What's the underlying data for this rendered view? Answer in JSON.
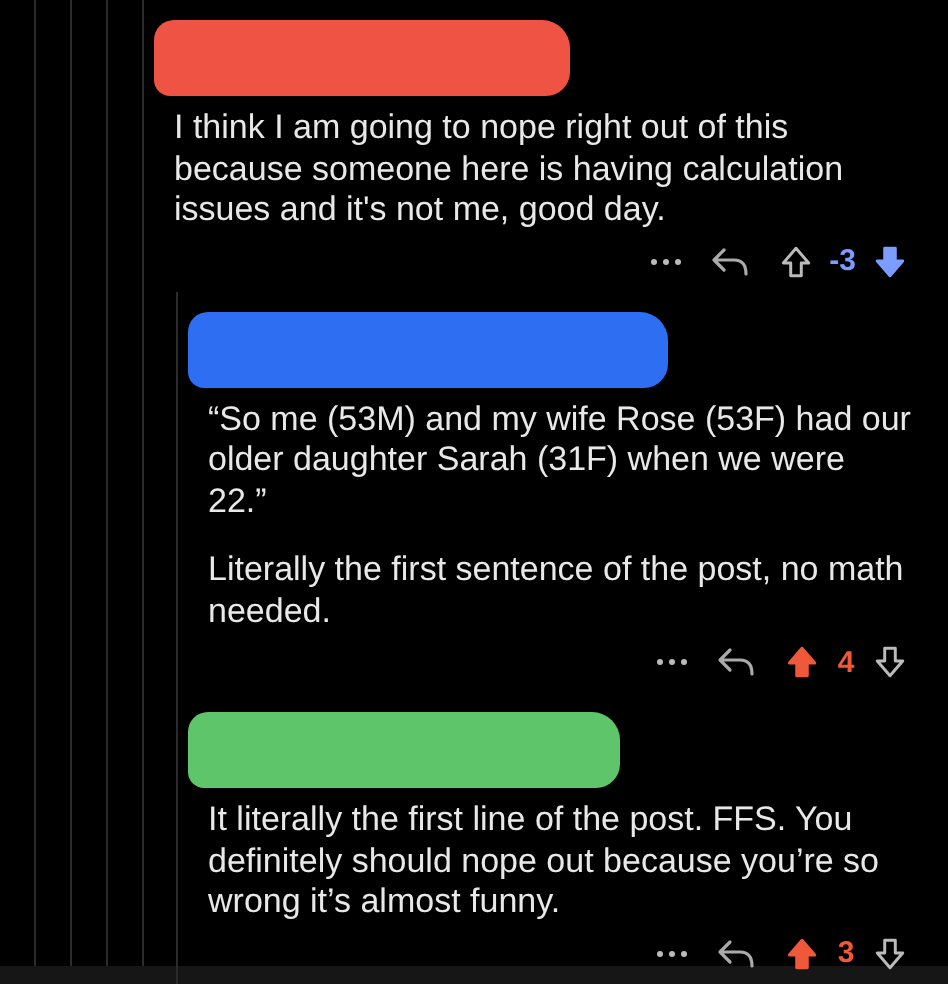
{
  "thread": {
    "comment": {
      "color": "#ee5344",
      "paragraphs": [
        "I think I am going to nope right out of this because someone here is having calculation issues and it's not me, good day."
      ],
      "score": "-3",
      "upvoted": false,
      "downvoted": true,
      "children": [
        {
          "color": "#2d6ef2",
          "paragraphs": [
            "“So me (53M) and my wife Rose (53F) had our older daughter Sarah (31F) when we were 22.”",
            "Literally the first sentence of the post, no math needed."
          ],
          "score": "4",
          "upvoted": true,
          "downvoted": false
        },
        {
          "color": "#5fc56a",
          "paragraphs": [
            "It literally the first line of the post. FFS. You definitely should nope out because you’re so wrong it’s almost funny."
          ],
          "score": "3",
          "upvoted": true,
          "downvoted": false
        }
      ]
    }
  }
}
